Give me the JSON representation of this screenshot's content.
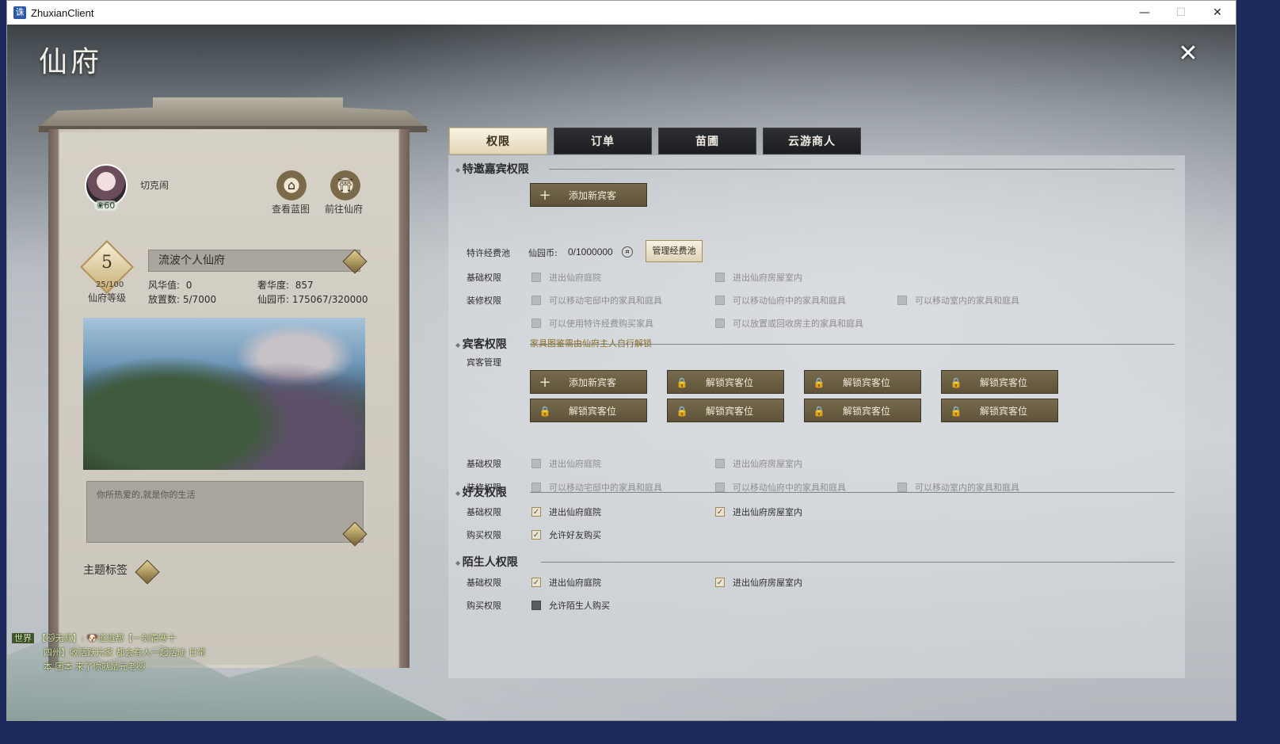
{
  "window": {
    "title": "ZhuxianClient",
    "app_icon": "zhuxian-icon",
    "controls": {
      "minimize": "—",
      "maximize": "☐",
      "close": "✕"
    }
  },
  "header": {
    "title": "仙府",
    "close_label": "✕"
  },
  "profile": {
    "player_name": "切克闹",
    "avatar_level": "60",
    "view_blueprint_label": "查看蓝图",
    "goto_home_label": "前往仙府",
    "home_level": "5",
    "home_exp": "25/100",
    "home_level_label": "仙府等级",
    "home_name": "流波个人仙府",
    "stats": {
      "elegance_label": "风华值:",
      "elegance_value": "0",
      "luxury_label": "奢华度:",
      "luxury_value": "857",
      "placed_label": "放置数:",
      "placed_value": "5/7000",
      "coin_label": "仙园币:",
      "coin_value": "175067/320000"
    },
    "motto": "你所热爱的,就是你的生活",
    "theme_label": "主题标签"
  },
  "chat": {
    "channel": "世界",
    "line1": "【🐱无叔】: 🐶道道都【一剑霜寒十",
    "line2": "四州】收活跃玩家 都会有人一起活动 日常",
    "line3": "本 团本 来了你就是元老🐱"
  },
  "tabs": [
    {
      "label": "权限",
      "active": true
    },
    {
      "label": "订单",
      "active": false
    },
    {
      "label": "苗圃",
      "active": false
    },
    {
      "label": "云游商人",
      "active": false
    }
  ],
  "special_guest": {
    "title": "特邀嘉宾权限",
    "add_guest_label": "添加新宾客",
    "pool_label": "特许经费池",
    "pool_coin_label": "仙园币:",
    "pool_coin_value": "0/1000000",
    "manage_pool_label": "管理经费池",
    "basic_label": "基础权限",
    "basic_opts": [
      "进出仙府庭院",
      "进出仙府房屋室内"
    ],
    "decor_label": "装修权限",
    "decor_opts": [
      "可以移动宅邸中的家具和庭具",
      "可以移动仙府中的家具和庭具",
      "可以移动室内的家具和庭具",
      "可以使用特许经费购买家具",
      "可以放置或回收房主的家具和庭具"
    ],
    "hint": "家具图鉴需由仙府主人自行解锁"
  },
  "guest": {
    "title": "宾客权限",
    "manage_label": "宾客管理",
    "add_guest_label": "添加新宾客",
    "unlock_label": "解锁宾客位",
    "basic_label": "基础权限",
    "basic_opts": [
      "进出仙府庭院",
      "进出仙府房屋室内"
    ],
    "decor_label": "装修权限",
    "decor_opts": [
      "可以移动宅邸中的家具和庭具",
      "可以移动仙府中的家具和庭具",
      "可以移动室内的家具和庭具"
    ]
  },
  "friend": {
    "title": "好友权限",
    "basic_label": "基础权限",
    "basic_opts": [
      "进出仙府庭院",
      "进出仙府房屋室内"
    ],
    "buy_label": "购买权限",
    "buy_opt": "允许好友购买"
  },
  "stranger": {
    "title": "陌生人权限",
    "basic_label": "基础权限",
    "basic_opts": [
      "进出仙府庭院",
      "进出仙府房屋室内"
    ],
    "buy_label": "购买权限",
    "buy_opt": "允许陌生人购买"
  }
}
